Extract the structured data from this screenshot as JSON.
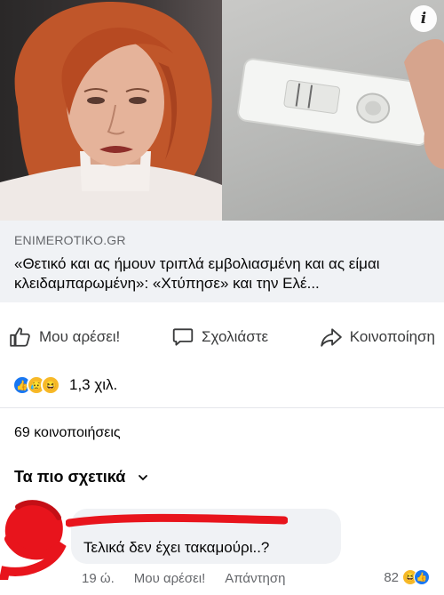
{
  "link": {
    "domain": "ENIMEROTIKO.GR",
    "title": "«Θετικό και ας ήμουν τριπλά εμβολιασμένη και ας είμαι κλειδαμπαρωμένη»: «Χτύπησε» και την Ελέ..."
  },
  "info_badge": "i",
  "actions": {
    "like_label": "Μου αρέσει!",
    "comment_label": "Σχολιάστε",
    "share_label": "Κοινοποίηση"
  },
  "reactions": {
    "count": "1,3 χιλ.",
    "icons": [
      "like-icon",
      "sad-icon",
      "haha-icon"
    ]
  },
  "shares_text": "69 κοινοποιήσεις",
  "sort": {
    "label": "Τα πιο σχετικά"
  },
  "comment": {
    "text": "Τελικά δεν έχει τακαμούρι..?",
    "time": "19 ώ.",
    "like_label": "Μου αρέσει!",
    "reply_label": "Απάντηση",
    "reaction_count": "82"
  },
  "colors": {
    "accent_blue": "#1877f2",
    "reaction_yellow": "#f7b928",
    "redaction_red": "#e8141c",
    "surface_grey": "#f0f2f5"
  }
}
